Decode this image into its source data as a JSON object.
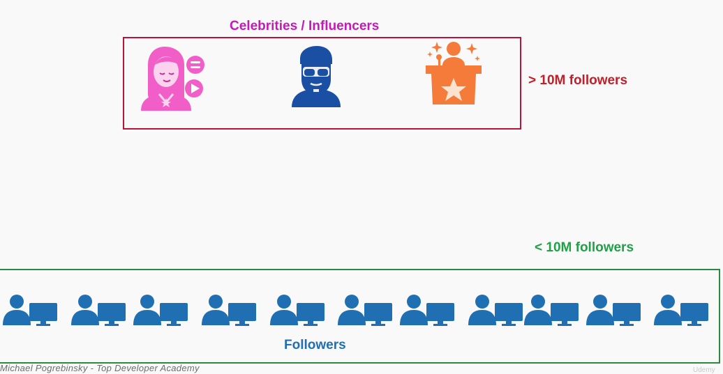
{
  "celebrities": {
    "title": "Celebrities / Influencers",
    "threshold_label": "> 10M followers",
    "icons": [
      "influencer-woman-icon",
      "bearded-man-sunglasses-icon",
      "speaker-podium-star-icon"
    ]
  },
  "followers": {
    "threshold_label": "< 10M followers",
    "label": "Followers",
    "icon": "user-at-computer-icon",
    "count": 11
  },
  "footer": {
    "watermark": "Michael Pogrebinsky - Top Developer Academy",
    "brand": "Udemy"
  },
  "colors": {
    "celebrity_title": "#c41bb6",
    "celebrity_border": "#b8143a",
    "gt_label": "#c0202a",
    "lt_label": "#22a048",
    "followers_border": "#2b8a3e",
    "followers_blue": "#1f6fb2",
    "influencer_pink": "#f25ec8",
    "man_blue": "#1b4fa3",
    "podium_orange": "#f47b3a"
  }
}
